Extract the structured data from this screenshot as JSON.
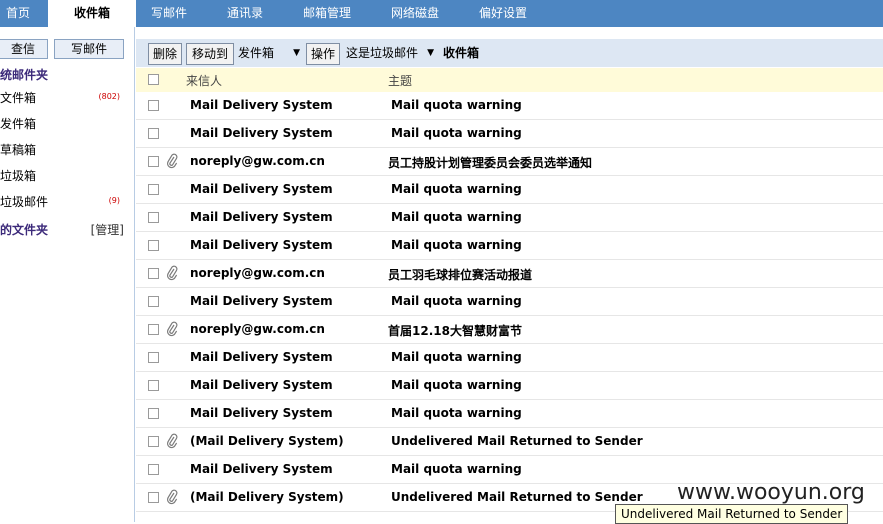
{
  "topnav": {
    "tabs": [
      {
        "label": "首页"
      },
      {
        "label": "收件箱"
      },
      {
        "label": "写邮件"
      },
      {
        "label": "通讯录"
      },
      {
        "label": "邮箱管理"
      },
      {
        "label": "网络磁盘"
      },
      {
        "label": "偏好设置"
      }
    ],
    "active_index": 1
  },
  "sidebar": {
    "check_mail": "查信",
    "compose": "写邮件",
    "system_folders_title": "统邮件夹",
    "folders": [
      {
        "label": "文件箱",
        "count": "(802)"
      },
      {
        "label": "发件箱",
        "count": ""
      },
      {
        "label": "草稿箱",
        "count": ""
      },
      {
        "label": "垃圾箱",
        "count": ""
      },
      {
        "label": "垃圾邮件",
        "count": "(9)"
      }
    ],
    "my_folders_title": "的文件夹",
    "manage": "[管理]"
  },
  "toolbar": {
    "delete": "删除",
    "move_to": "移动到",
    "move_target": "发件箱",
    "operate": "操作",
    "spam_select": "这是垃圾邮件",
    "current_folder": "收件箱"
  },
  "list": {
    "header_sender": "来信人",
    "header_subject": "主题",
    "rows": [
      {
        "sender": "Mail Delivery System",
        "subject": "Mail quota warning",
        "attach": false
      },
      {
        "sender": "Mail Delivery System",
        "subject": "Mail quota warning",
        "attach": false
      },
      {
        "sender": "noreply@gw.com.cn",
        "subject": "员工持股计划管理委员会委员选举通知",
        "attach": true
      },
      {
        "sender": "Mail Delivery System",
        "subject": "Mail quota warning",
        "attach": false
      },
      {
        "sender": "Mail Delivery System",
        "subject": "Mail quota warning",
        "attach": false
      },
      {
        "sender": "Mail Delivery System",
        "subject": "Mail quota warning",
        "attach": false
      },
      {
        "sender": "noreply@gw.com.cn",
        "subject": "员工羽毛球排位赛活动报道",
        "attach": true
      },
      {
        "sender": "Mail Delivery System",
        "subject": "Mail quota warning",
        "attach": false
      },
      {
        "sender": "noreply@gw.com.cn",
        "subject": "首届12.18大智慧财富节",
        "attach": true
      },
      {
        "sender": "Mail Delivery System",
        "subject": "Mail quota warning",
        "attach": false
      },
      {
        "sender": "Mail Delivery System",
        "subject": "Mail quota warning",
        "attach": false
      },
      {
        "sender": "Mail Delivery System",
        "subject": "Mail quota warning",
        "attach": false
      },
      {
        "sender": "(Mail Delivery System)",
        "subject": "Undelivered Mail Returned to Sender",
        "attach": true
      },
      {
        "sender": "Mail Delivery System",
        "subject": "Mail quota warning",
        "attach": false
      },
      {
        "sender": "(Mail Delivery System)",
        "subject": "Undelivered Mail Returned to Sender",
        "attach": true
      }
    ]
  },
  "tooltip": "Undelivered Mail Returned to Sender",
  "watermark": "www.wooyun.org",
  "colors": {
    "nav_bg": "#4d86c2",
    "toolbar_bg": "#dde7f3",
    "header_bg": "#fffbd9",
    "folder_title": "#3c2a7a",
    "count_red": "#cc0000"
  }
}
